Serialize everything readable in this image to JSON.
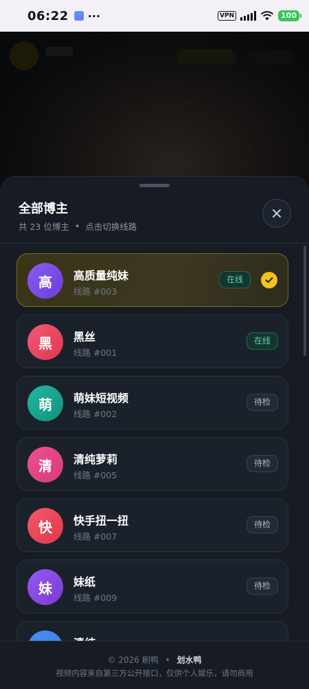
{
  "status_bar": {
    "time": "06:22",
    "dots": "···",
    "vpn": "VPN",
    "battery": "100"
  },
  "sheet": {
    "title": "全部博主",
    "subtitle_count": "共 23 位博主",
    "subtitle_separator": "•",
    "subtitle_hint": "点击切换线路",
    "close_icon": "close-icon"
  },
  "streamers": [
    {
      "avatar_char": "高",
      "name": "高质量纯妹",
      "route": "线路 #003",
      "status": "在线",
      "status_type": "online",
      "selected": true,
      "color_a": "#8a5cf0",
      "color_b": "#6a3fd8"
    },
    {
      "avatar_char": "黑",
      "name": "黑丝",
      "route": "线路 #001",
      "status": "在线",
      "status_type": "online",
      "selected": false,
      "color_a": "#f05a74",
      "color_b": "#e0384f"
    },
    {
      "avatar_char": "萌",
      "name": "萌妹短视频",
      "route": "线路 #002",
      "status": "待检",
      "status_type": "pending",
      "selected": false,
      "color_a": "#22b7a0",
      "color_b": "#12927f"
    },
    {
      "avatar_char": "清",
      "name": "清纯萝莉",
      "route": "线路 #005",
      "status": "待检",
      "status_type": "pending",
      "selected": false,
      "color_a": "#f0508f",
      "color_b": "#d63b79"
    },
    {
      "avatar_char": "快",
      "name": "快手扭一扭",
      "route": "线路 #007",
      "status": "待检",
      "status_type": "pending",
      "selected": false,
      "color_a": "#f25869",
      "color_b": "#de3a4c"
    },
    {
      "avatar_char": "妹",
      "name": "妹纸",
      "route": "线路 #009",
      "status": "待检",
      "status_type": "pending",
      "selected": false,
      "color_a": "#9558ee",
      "color_b": "#7a3bd6"
    },
    {
      "avatar_char": "",
      "name": "清纯",
      "route": "",
      "status": "",
      "status_type": "pending",
      "selected": false,
      "color_a": "#4a90f5",
      "color_b": "#3a78e0"
    }
  ],
  "footer": {
    "copyright": "© 2026 刷鸭",
    "separator": "•",
    "brand": "划水鸭",
    "disclaimer": "视频内容来自第三方公开接口，仅供个人娱乐，请勿商用"
  },
  "colors": {
    "accent": "#f2c319",
    "online_text": "#5fd6b0",
    "sheet_bg": "#161b24"
  }
}
